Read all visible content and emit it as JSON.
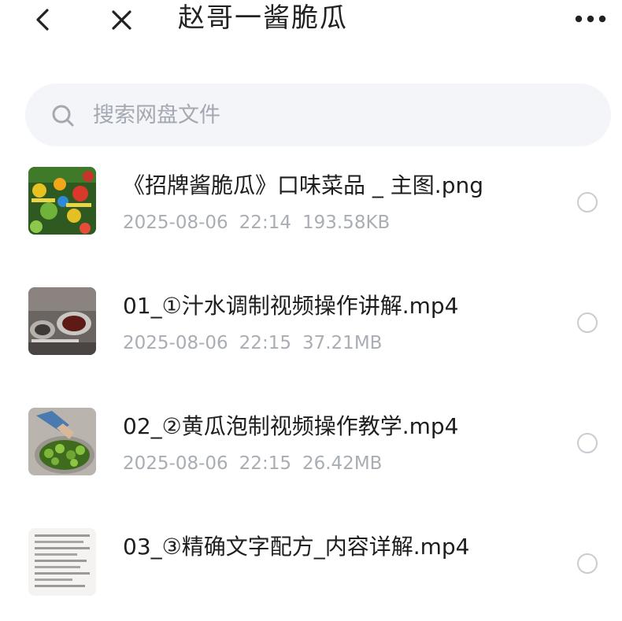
{
  "header": {
    "title": "赵哥一酱脆瓜",
    "back_icon": "back-arrow-icon",
    "close_icon": "close-icon",
    "more_icon": "more-dots-icon"
  },
  "search": {
    "placeholder": "搜索网盘文件",
    "value": "",
    "icon": "search-icon"
  },
  "files": [
    {
      "name": "《招牌酱脆瓜》口味菜品 _ 主图.png",
      "date": "2025-08-06",
      "time": "22:14",
      "size": "193.58KB",
      "thumb": "image-thumbnail"
    },
    {
      "name": "01_①汁水调制视频操作讲解.mp4",
      "date": "2025-08-06",
      "time": "22:15",
      "size": "37.21MB",
      "thumb": "video-thumbnail"
    },
    {
      "name": "02_②黄瓜泡制视频操作教学.mp4",
      "date": "2025-08-06",
      "time": "22:15",
      "size": "26.42MB",
      "thumb": "video-thumbnail"
    },
    {
      "name": "03_③精确文字配方_内容详解.mp4",
      "date": "",
      "time": "",
      "size": "",
      "thumb": "document-thumbnail"
    }
  ],
  "colors": {
    "search_bg": "#f3f5f8",
    "meta_text": "#a9adb4",
    "radio_border": "#c9ccd1"
  }
}
